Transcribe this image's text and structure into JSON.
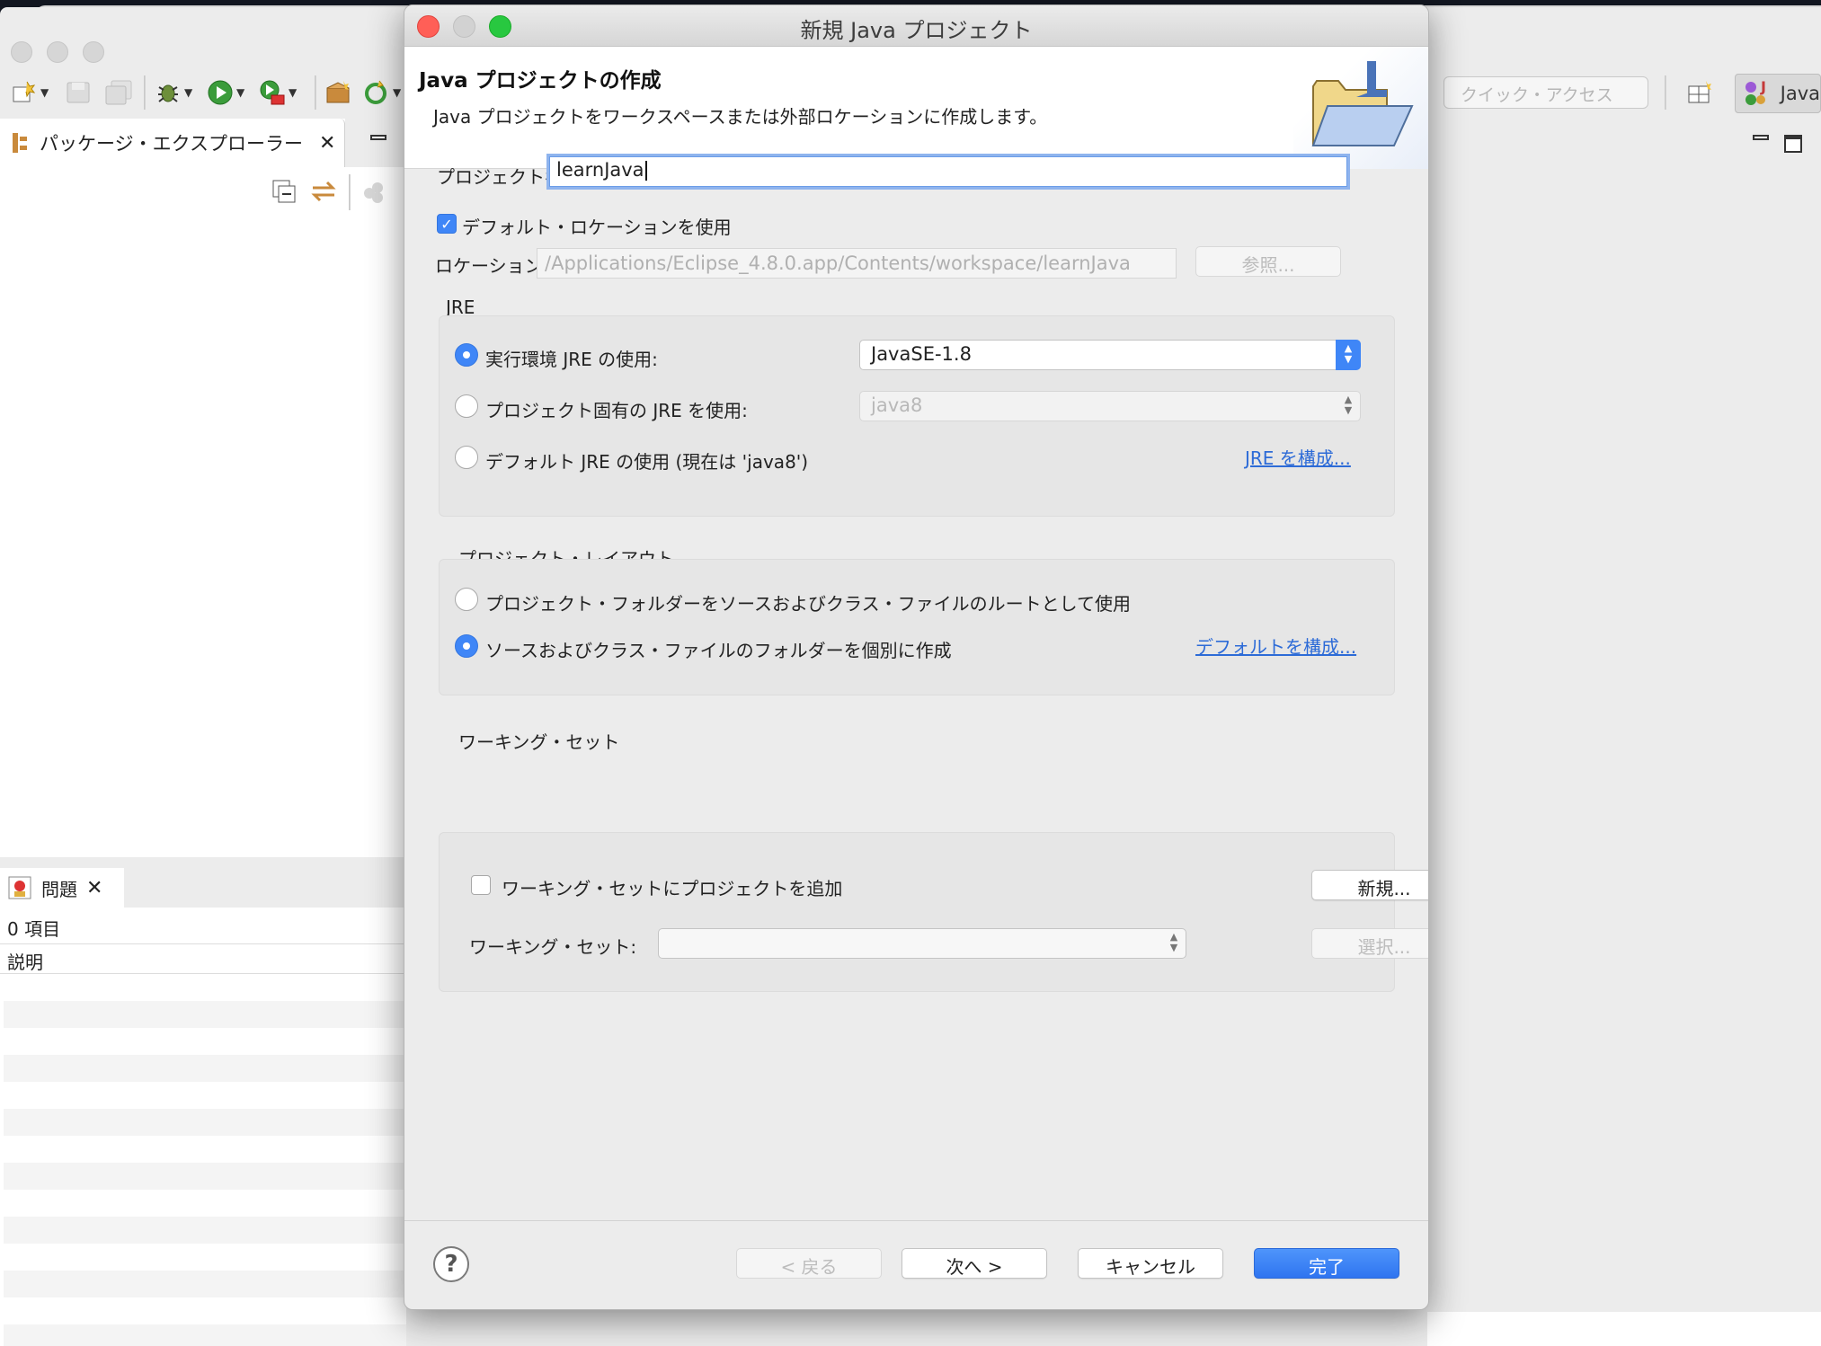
{
  "background_window": {
    "toolbar": {
      "quick_access_placeholder": "クイック・アクセス",
      "perspective_label": "Java"
    },
    "package_explorer": {
      "tab_label": "パッケージ・エクスプローラー"
    },
    "problems": {
      "tab_label": "問題",
      "count": "0 項目",
      "column_description": "説明"
    }
  },
  "dialog": {
    "window_title": "新規 Java プロジェクト",
    "header": {
      "title": "Java プロジェクトの作成",
      "description": "Java プロジェクトをワークスペースまたは外部ロケーションに作成します。"
    },
    "project_name": {
      "label": "プロジェクト名:",
      "value": "learnJava"
    },
    "use_default_location": {
      "label": "デフォルト・ロケーションを使用",
      "checked": true
    },
    "location": {
      "label": "ロケーション:",
      "value": "/Applications/Eclipse_4.8.0.app/Contents/workspace/learnJava",
      "browse_label": "参照..."
    },
    "jre": {
      "section_label": "JRE",
      "options": [
        {
          "label": "実行環境 JRE の使用:",
          "selected": true
        },
        {
          "label": "プロジェクト固有の JRE を使用:",
          "selected": false
        },
        {
          "label": "デフォルト JRE の使用 (現在は 'java8')",
          "selected": false
        }
      ],
      "execution_env_value": "JavaSE-1.8",
      "project_specific_value": "java8",
      "configure_link": "JRE を構成..."
    },
    "project_layout": {
      "section_label": "プロジェクト・レイアウト",
      "options": [
        {
          "label": "プロジェクト・フォルダーをソースおよびクラス・ファイルのルートとして使用",
          "selected": false
        },
        {
          "label": "ソースおよびクラス・ファイルのフォルダーを個別に作成",
          "selected": true
        }
      ],
      "configure_link": "デフォルトを構成..."
    },
    "working_sets": {
      "section_label": "ワーキング・セット",
      "add_label": "ワーキング・セットにプロジェクトを追加",
      "add_checked": false,
      "new_button": "新規...",
      "sets_label": "ワーキング・セット:",
      "sets_value": "",
      "select_button": "選択..."
    },
    "footer": {
      "back": "< 戻る",
      "next": "次へ >",
      "cancel": "キャンセル",
      "finish": "完了"
    }
  },
  "colors": {
    "accent": "#3f86f7",
    "link": "#2d6bd7",
    "close": "#ff5f57",
    "zoom": "#28c840"
  }
}
